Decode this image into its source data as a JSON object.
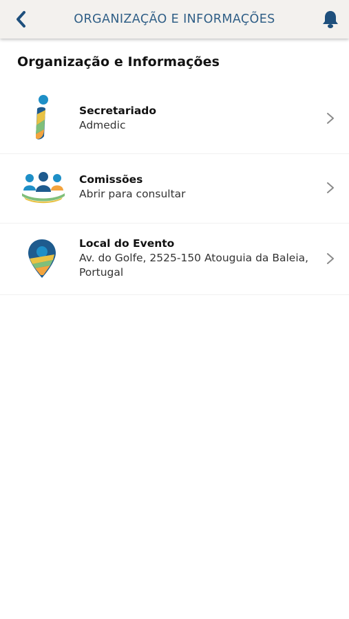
{
  "header": {
    "title": "ORGANIZAÇÃO E INFORMAÇÕES",
    "back_icon": "chevron-left-icon",
    "bell_icon": "bell-icon"
  },
  "section": {
    "title": "Organização e Informações"
  },
  "items": [
    {
      "title": "Secretariado",
      "subtitle": "Admedic",
      "icon": "info-icon"
    },
    {
      "title": "Comissões",
      "subtitle": "Abrir para consultar",
      "icon": "people-group-icon"
    },
    {
      "title": "Local do Evento",
      "subtitle": "Av. do Golfe, 2525-150 Atouguia da Baleia, Portugal",
      "icon": "location-pin-icon"
    }
  ],
  "colors": {
    "header_bg": "#f3f1ee",
    "brand_blue": "#1e5b8e",
    "accent_teal": "#1e8fc7",
    "accent_yellow": "#e8c245",
    "accent_orange": "#f3a43e",
    "accent_green": "#7fbf7a"
  }
}
